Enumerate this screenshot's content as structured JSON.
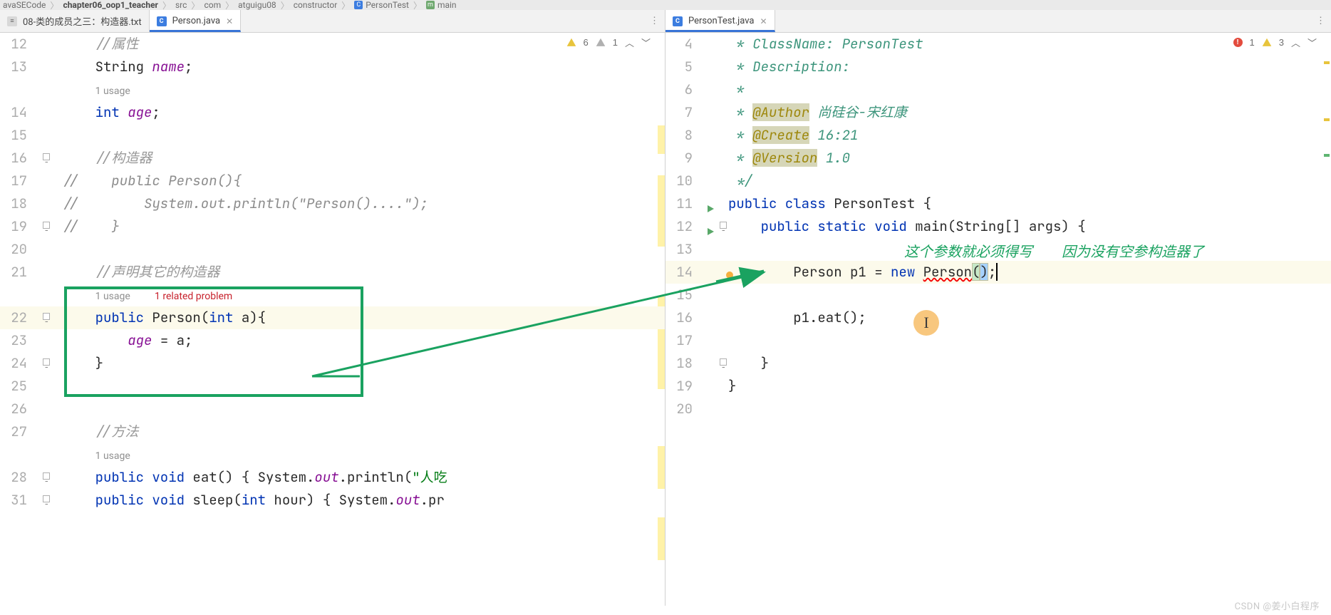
{
  "breadcrumbs": {
    "project": "avaSECode",
    "module": "chapter06_oop1_teacher",
    "items": [
      "src",
      "com",
      "atguigu08",
      "constructor"
    ],
    "class": "PersonTest",
    "method": "main"
  },
  "left": {
    "tabs": [
      {
        "name": "08-类的成员之三：构造器.txt",
        "type": "txt",
        "selected": false
      },
      {
        "name": "Person.java",
        "type": "java",
        "selected": true
      }
    ],
    "problems": {
      "warn": "6",
      "info": "1"
    },
    "usages": "1 usage",
    "constructor_usage": "1 usage",
    "related": "1 related problem",
    "method_usage": "1 usage",
    "lines": {
      "l12": {
        "n": "12",
        "code": "    //属性"
      },
      "l13": {
        "n": "13",
        "code": "    String name;"
      },
      "l13u": {
        "usage": "1 usage"
      },
      "l14": {
        "n": "14",
        "code": "    int age;"
      },
      "l15": {
        "n": "15",
        "code": ""
      },
      "l16": {
        "n": "16",
        "code": "    //构造器"
      },
      "l17": {
        "n": "17",
        "code": "//    public Person(){"
      },
      "l18": {
        "n": "18",
        "code": "//        System.out.println(\"Person()....\");"
      },
      "l19": {
        "n": "19",
        "code": "//    }"
      },
      "l20": {
        "n": "20",
        "code": ""
      },
      "l21": {
        "n": "21",
        "code": "    //声明其它的构造器"
      },
      "l22": {
        "n": "22",
        "code": "    public Person(int a){"
      },
      "l23": {
        "n": "23",
        "code": "        age = a;"
      },
      "l24": {
        "n": "24",
        "code": "    }"
      },
      "l25": {
        "n": "25",
        "code": ""
      },
      "l26": {
        "n": "26",
        "code": ""
      },
      "l27": {
        "n": "27",
        "code": "    //方法"
      },
      "l28": {
        "n": "28",
        "code": "    public void eat() { System.out.println(\"人吃"
      },
      "l31": {
        "n": "31",
        "code": "    public void sleep(int hour) { System.out.pr"
      }
    }
  },
  "right": {
    "tabs": [
      {
        "name": "PersonTest.java",
        "type": "java",
        "selected": true
      }
    ],
    "problems": {
      "err": "1",
      "warn": "3"
    },
    "annotation1": "这个参数就必须得写",
    "annotation2": "因为没有空参构造器了",
    "doc": {
      "classname": " * ClassName: PersonTest",
      "description": " * Description:",
      "star": " *",
      "author_tag": "@Author",
      "author_val": " 尚硅谷-宋红康",
      "create_tag": "@Create",
      "create_val": "16:21",
      "version_tag": "@Version",
      "version_val": "1.0",
      "end": " */"
    },
    "lines": {
      "l4": {
        "n": "4"
      },
      "l5": {
        "n": "5"
      },
      "l6": {
        "n": "6"
      },
      "l7": {
        "n": "7"
      },
      "l8": {
        "n": "8"
      },
      "l9": {
        "n": "9"
      },
      "l10": {
        "n": "10"
      },
      "l11": {
        "n": "11"
      },
      "l12": {
        "n": "12"
      },
      "l13": {
        "n": "13"
      },
      "l14": {
        "n": "14"
      },
      "l15": {
        "n": "15"
      },
      "l16": {
        "n": "16"
      },
      "l17": {
        "n": "17"
      },
      "l18": {
        "n": "18"
      },
      "l19": {
        "n": "19"
      },
      "l20": {
        "n": "20"
      }
    }
  },
  "watermark": "CSDN @姜小白程序"
}
